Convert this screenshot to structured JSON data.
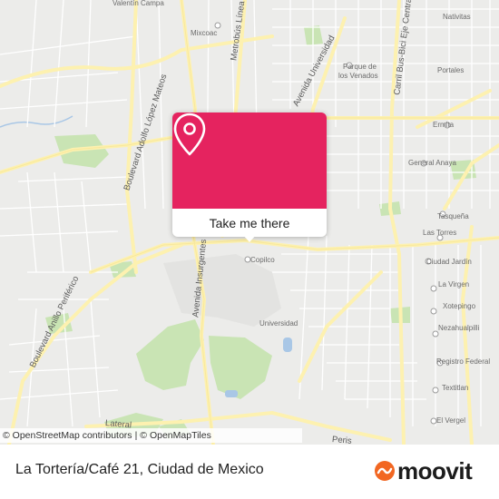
{
  "map": {
    "labels": {
      "valentin_campa": "Valentín Campa",
      "mixcoac": "Mixcoac",
      "metrobus_linea": "Metrobús Línea",
      "avenida_universidad": "Avenida Universidad",
      "parque_venados_1": "Parque de",
      "parque_venados_2": "los Venados",
      "carril_bus_bici": "Carril Bus-Bici Eje Central",
      "navitas": "Nativitas",
      "portales": "Portales",
      "ermita": "Ermita",
      "general_anaya": "General Anaya",
      "boulevard_adolfo": "Boulevard Adolfo López Mateos",
      "avenida_insurgentes": "Avenida Insurgentes Sur",
      "copilco": "Copilco",
      "tasquena": "Tasqueña",
      "las_torres": "Las Torres",
      "ciudad_jardin": "Ciudad Jardín",
      "la_virgen": "La Virgen",
      "xotepingo": "Xotepingo",
      "nezahualpilli": "Nezahualpilli",
      "registro_federal": "Registro Federal",
      "textitlan": "Textitlan",
      "el_vergel": "El Vergel",
      "universidad": "Universidad",
      "boulevard_anillo": "Boulevard Anillo Periférico",
      "lateral": "Lateral",
      "periferico": "Peris"
    },
    "accent_color": "#e5235f",
    "park_color": "#c9e4b4",
    "road_color": "#fdf1b0"
  },
  "attribution": {
    "osm": "© OpenStreetMap contributors",
    "separator": "|",
    "omt": "© OpenMapTiles"
  },
  "popup": {
    "button_label": "Take me there",
    "icon": "location-pin-icon"
  },
  "footer": {
    "place_name": "La Tortería/Café 21, Ciudad de Mexico",
    "brand_name": "moovit",
    "brand_icon": "moovit-logo-icon",
    "brand_color": "#f26722"
  }
}
